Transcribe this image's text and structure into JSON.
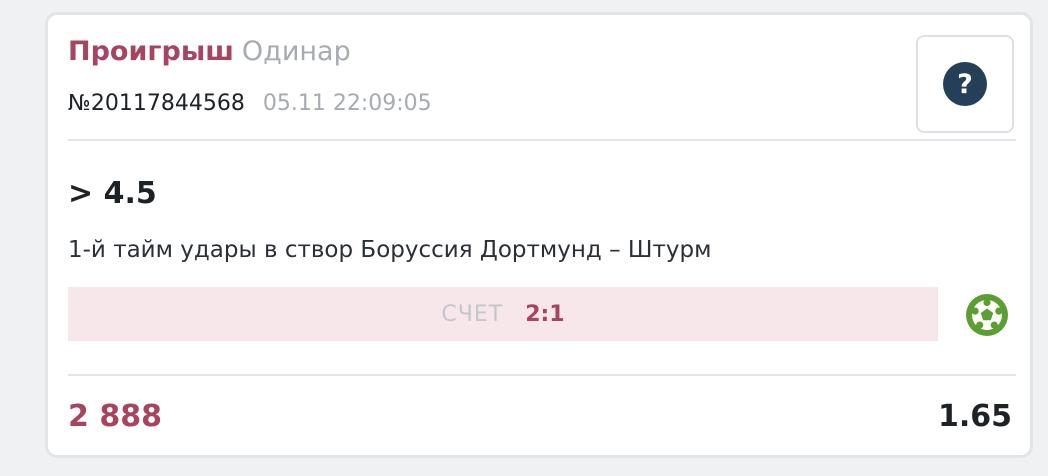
{
  "bet": {
    "status": "Проигрыш",
    "type": "Одинар",
    "number": "№20117844568",
    "datetime": "05.11 22:09:05",
    "outcome": "> 4.5",
    "market": "1-й тайм удары в створ Боруссия Дортмунд – Штурм",
    "score_label": "СЧЕТ",
    "score_value": "2:1",
    "stake": "2 888",
    "odds": "1.65"
  },
  "help": {
    "symbol": "?",
    "icon": "question-circle-icon"
  },
  "sport": {
    "icon": "football-icon",
    "color": "#5c9e31"
  },
  "colors": {
    "loss": "#a5455f",
    "muted": "#a6abb1",
    "score_bg": "#f7e6ea",
    "help_bg": "#243f57"
  }
}
